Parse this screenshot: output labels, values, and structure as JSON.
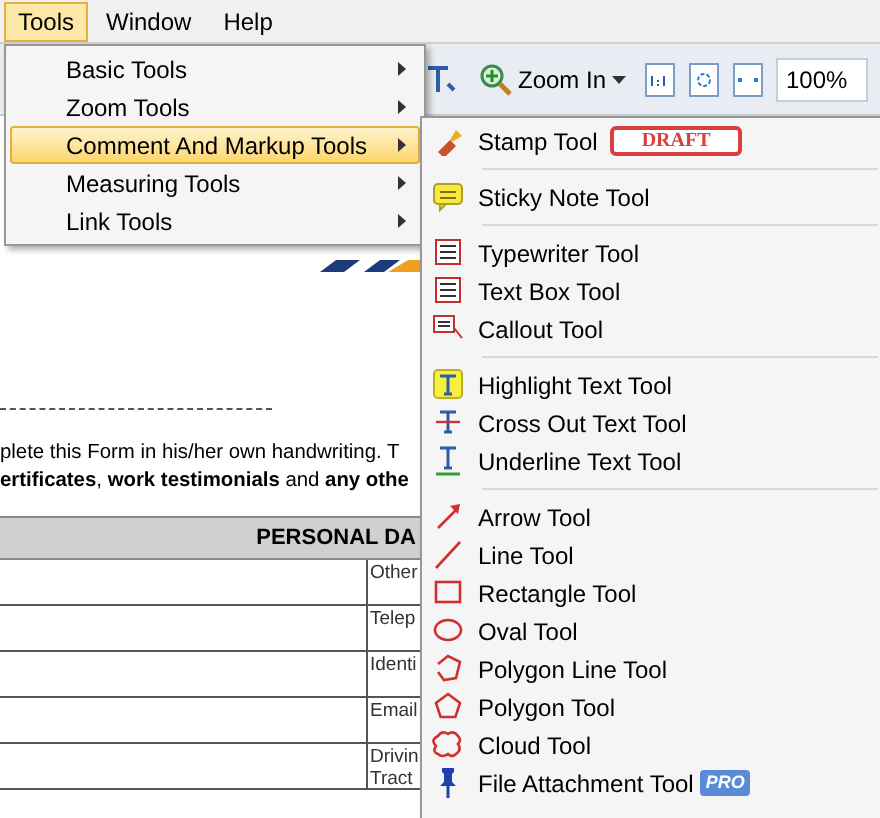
{
  "menu_bar": [
    {
      "label": "Tools",
      "selected": true
    },
    {
      "label": "Window",
      "selected": false
    },
    {
      "label": "Help",
      "selected": false
    }
  ],
  "toolbar": {
    "zoom_button": "Zoom In",
    "zoom_value": "100%"
  },
  "tools_menu": [
    {
      "label": "Basic Tools",
      "selected": false
    },
    {
      "label": "Zoom Tools",
      "selected": false
    },
    {
      "label": "Comment And Markup Tools",
      "selected": true
    },
    {
      "label": "Measuring Tools",
      "selected": false
    },
    {
      "label": "Link Tools",
      "selected": false
    }
  ],
  "submenu_groups": [
    [
      {
        "label": "Stamp Tool",
        "kind": "stamp",
        "stamp_preview": "DRAFT"
      }
    ],
    [
      {
        "label": "Sticky Note Tool",
        "kind": "note"
      }
    ],
    [
      {
        "label": "Typewriter Tool",
        "kind": "typewriter"
      },
      {
        "label": "Text Box Tool",
        "kind": "textbox"
      },
      {
        "label": "Callout Tool",
        "kind": "callout"
      }
    ],
    [
      {
        "label": "Highlight Text Tool",
        "kind": "highlight"
      },
      {
        "label": "Cross Out Text Tool",
        "kind": "crossout"
      },
      {
        "label": "Underline Text Tool",
        "kind": "underline"
      }
    ],
    [
      {
        "label": "Arrow Tool",
        "kind": "arrow"
      },
      {
        "label": "Line Tool",
        "kind": "line"
      },
      {
        "label": "Rectangle Tool",
        "kind": "rectangle"
      },
      {
        "label": "Oval Tool",
        "kind": "oval"
      },
      {
        "label": "Polygon Line Tool",
        "kind": "polyline"
      },
      {
        "label": "Polygon Tool",
        "kind": "polygon"
      },
      {
        "label": "Cloud Tool",
        "kind": "cloud"
      },
      {
        "label": "File Attachment Tool",
        "kind": "pin",
        "badge": "PRO"
      }
    ]
  ],
  "document": {
    "paragraph": [
      "plete this Form in his/her own handwriting. T",
      "**ertificates**, **work testimonials** and **any othe**"
    ],
    "table_header": "PERSONAL DA",
    "row_labels": [
      "Other",
      "Telep",
      "Identi",
      "Email",
      "Drivin Tract"
    ]
  }
}
